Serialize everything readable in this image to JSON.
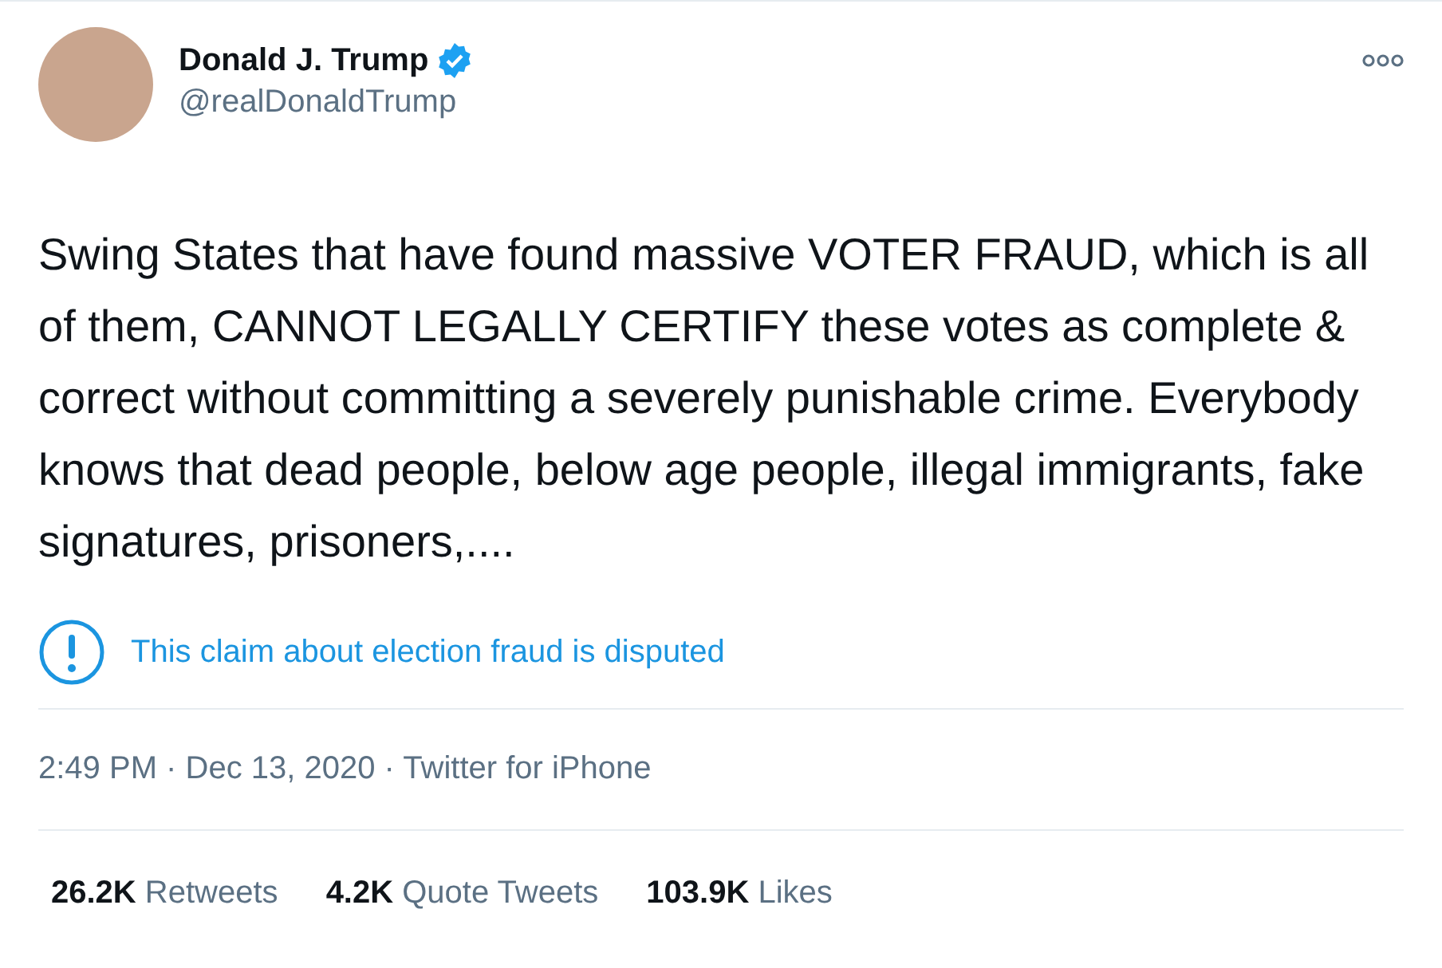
{
  "author": {
    "name": "Donald J. Trump",
    "verified": true,
    "handle": "@realDonaldTrump"
  },
  "text": "Swing States that have found massive VOTER FRAUD, which is all of them, CANNOT LEGALLY CERTIFY these votes as complete & correct without committing a severely punishable crime. Everybody knows that dead people, below age people, illegal immigrants, fake signatures, prisoners,....",
  "notice": "This claim about election fraud is disputed",
  "meta": "2:49 PM · Dec 13, 2020 · Twitter for iPhone",
  "stats": [
    {
      "count": "26.2K",
      "label": "Retweets"
    },
    {
      "count": "4.2K",
      "label": "Quote Tweets"
    },
    {
      "count": "103.9K",
      "label": "Likes"
    }
  ]
}
